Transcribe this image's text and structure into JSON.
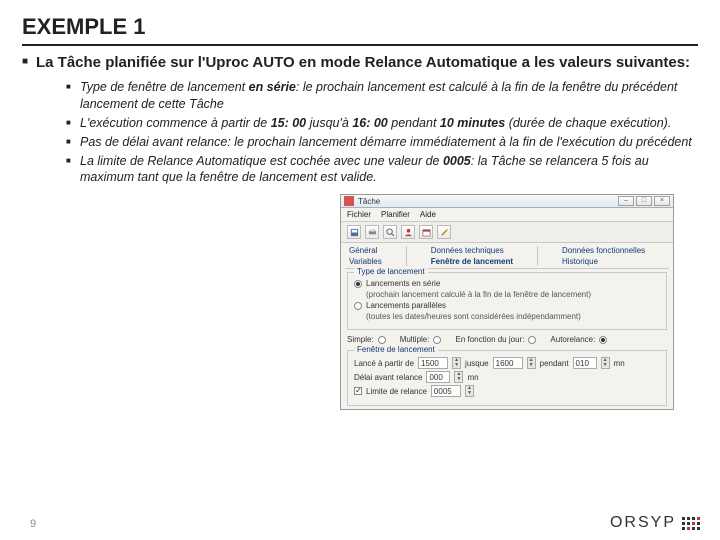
{
  "title": "EXEMPLE 1",
  "lead": "La Tâche planifiée sur l'Uproc AUTO en mode Relance Automatique a les valeurs suivantes:",
  "bullets": {
    "b1_pre": "Type de fenêtre de lancement ",
    "b1_bold": "en série",
    "b1_post": ": le prochain lancement est calculé à la fin de la fenêtre du précédent lancement de cette Tâche",
    "b2_pre": "L'exécution commence à partir de ",
    "b2_t1": "15: 00",
    "b2_mid1": "  jusqu'à ",
    "b2_t2": "16: 00",
    "b2_mid2": "  pendant  ",
    "b2_t3": "10 minutes",
    "b2_post": " (durée de chaque exécution).",
    "b3": "Pas de délai avant relance: le prochain lancement démarre immédiatement à la fin de l'exécution du précédent",
    "b4_pre": "La limite de Relance Automatique est cochée avec une valeur de ",
    "b4_bold": "0005",
    "b4_post": ": la Tâche se relancera 5 fois au maximum tant que la fenêtre de lancement est valide."
  },
  "window": {
    "title": "Tâche",
    "menus": [
      "Fichier",
      "Planifier",
      "Aide"
    ],
    "tabs_col1": [
      "Général",
      "Variables"
    ],
    "tabs_col2": [
      "Données techniques",
      "Fenêtre de lancement"
    ],
    "tabs_col3": [
      "Données fonctionnelles",
      "Historique"
    ],
    "group_type_legend": "Type de lancement",
    "radio_serie": "Lancements en série",
    "radio_serie_sub": "(prochain lancement calculé à la fin de la fenêtre de lancement)",
    "radio_para": "Lancements parallèles",
    "radio_para_sub": "(toutes les dates/heures sont considérées indépendamment)",
    "mode_labels": {
      "simple": "Simple:",
      "multiple": "Multiple:",
      "fonction": "En fonction du jour:",
      "auto": "Autorelance:"
    },
    "group_fenetre_legend": "Fenêtre de lancement",
    "lance_label": "Lancé à partir de",
    "t_from": "1500",
    "jusque_label": "jusque",
    "t_to": "1600",
    "pendant_label": "pendant",
    "mins": "010",
    "mn": "mn",
    "delai_label": "Délai avant relance",
    "delai_val": "000",
    "relance_label": "Limite de relance",
    "relance_val": "0005"
  },
  "page_number": "9",
  "brand": "ORSYP"
}
